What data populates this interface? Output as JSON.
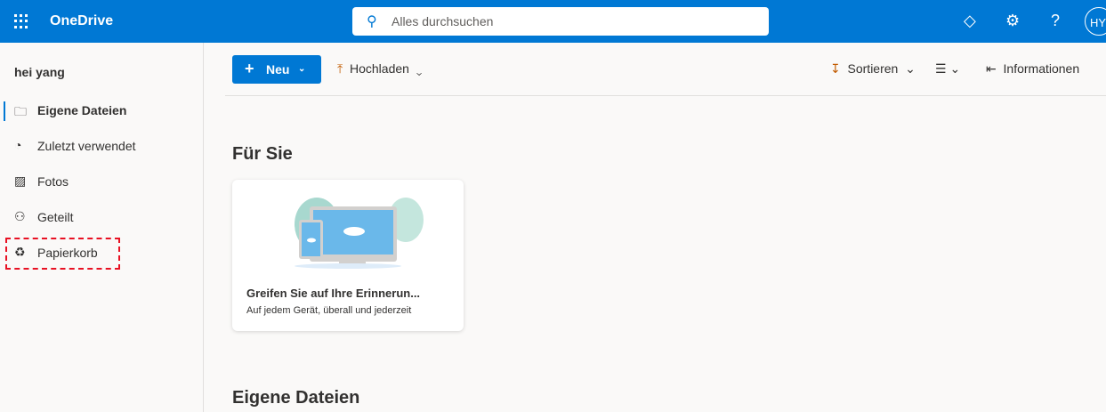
{
  "header": {
    "app_name": "OneDrive",
    "search_placeholder": "Alles durchsuchen",
    "avatar_initials": "HY"
  },
  "sidebar": {
    "user_name": "hei yang",
    "items": [
      {
        "label": "Eigene Dateien",
        "icon": "folder-icon"
      },
      {
        "label": "Zuletzt verwendet",
        "icon": "history-icon"
      },
      {
        "label": "Fotos",
        "icon": "photo-icon"
      },
      {
        "label": "Geteilt",
        "icon": "people-icon"
      },
      {
        "label": "Papierkorb",
        "icon": "recycle-bin-icon"
      }
    ]
  },
  "toolbar": {
    "new_label": "Neu",
    "upload_label": "Hochladen",
    "sort_label": "Sortieren",
    "info_label": "Informationen"
  },
  "main": {
    "for_you_heading": "Für Sie",
    "card_title": "Greifen Sie auf Ihre Erinnerun...",
    "card_subtitle": "Auf jedem Gerät, überall und jederzeit",
    "my_files_heading": "Eigene Dateien"
  },
  "colors": {
    "brand": "#0078d4",
    "highlight": "#e81123"
  }
}
